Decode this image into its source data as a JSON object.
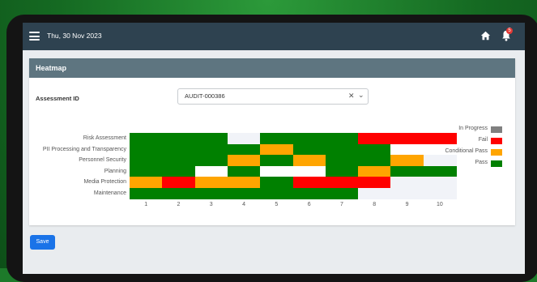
{
  "topbar": {
    "date": "Thu, 30 Nov 2023",
    "notification_count": "5"
  },
  "card": {
    "title": "Heatmap",
    "assessment_label": "Assessment ID",
    "assessment_value": "AUDIT-000386"
  },
  "actions": {
    "save_label": "Save"
  },
  "colors": {
    "In Progress": "#808080",
    "Fail": "#ff0000",
    "Conditional Pass": "#ffa500",
    "Pass": "#008000",
    "Empty": "#ffffff",
    "Faint": "#f1f3f8"
  },
  "chart_data": {
    "type": "heatmap",
    "x": [
      "1",
      "2",
      "3",
      "4",
      "5",
      "6",
      "7",
      "8",
      "9",
      "10"
    ],
    "y": [
      "Risk Assessment",
      "PII Processing and Transparency",
      "Personnel Security",
      "Planning",
      "Media Protection",
      "Maintenance"
    ],
    "legend": [
      "In Progress",
      "Fail",
      "Conditional Pass",
      "Pass"
    ],
    "legend_position": "right",
    "values": [
      [
        "Pass",
        "Pass",
        "Pass",
        "Faint",
        "Pass",
        "Pass",
        "Pass",
        "Fail",
        "Fail",
        "Fail"
      ],
      [
        "Pass",
        "Pass",
        "Pass",
        "Pass",
        "Conditional Pass",
        "Pass",
        "Pass",
        "Pass",
        "Empty",
        "Empty"
      ],
      [
        "Pass",
        "Pass",
        "Pass",
        "Conditional Pass",
        "Pass",
        "Conditional Pass",
        "Pass",
        "Pass",
        "Conditional Pass",
        "Faint"
      ],
      [
        "Pass",
        "Pass",
        "Empty",
        "Pass",
        "Empty",
        "Empty",
        "Pass",
        "Conditional Pass",
        "Pass",
        "Pass"
      ],
      [
        "Conditional Pass",
        "Fail",
        "Conditional Pass",
        "Conditional Pass",
        "Pass",
        "Fail",
        "Fail",
        "Fail",
        "Faint",
        "Faint"
      ],
      [
        "Pass",
        "Pass",
        "Pass",
        "Pass",
        "Pass",
        "Pass",
        "Pass",
        "Faint",
        "Faint",
        "Faint"
      ]
    ]
  }
}
